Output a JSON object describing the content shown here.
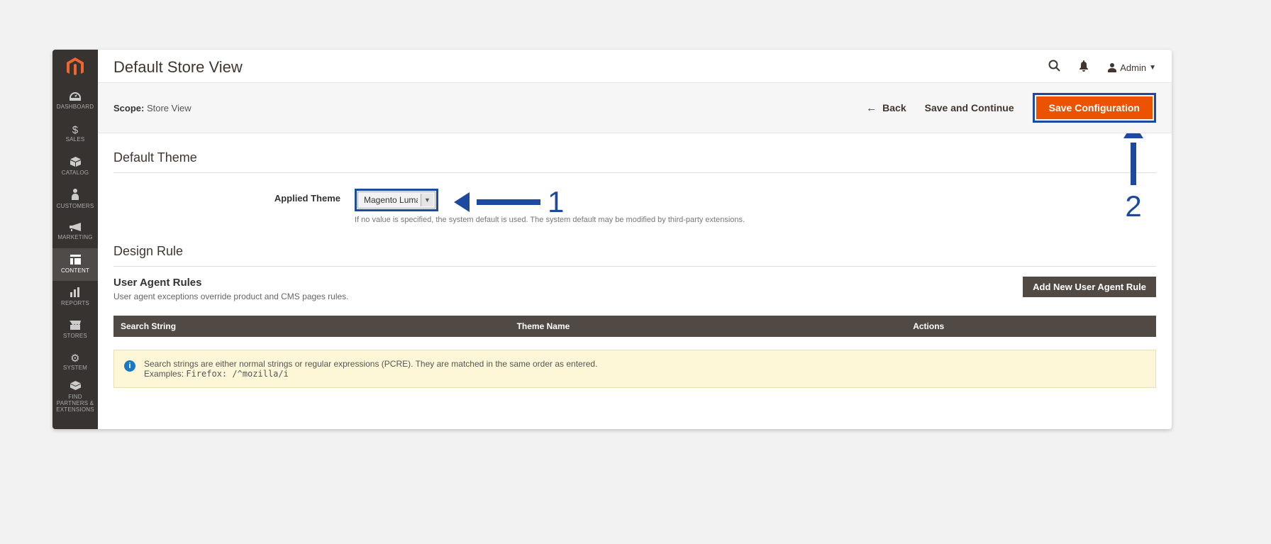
{
  "sidebar": {
    "items": [
      {
        "label": "DASHBOARD"
      },
      {
        "label": "SALES"
      },
      {
        "label": "CATALOG"
      },
      {
        "label": "CUSTOMERS"
      },
      {
        "label": "MARKETING"
      },
      {
        "label": "CONTENT"
      },
      {
        "label": "REPORTS"
      },
      {
        "label": "STORES"
      },
      {
        "label": "SYSTEM"
      },
      {
        "label": "FIND PARTNERS & EXTENSIONS"
      }
    ]
  },
  "header": {
    "title": "Default Store View",
    "user": "Admin"
  },
  "scope": {
    "label": "Scope:",
    "value": "Store View",
    "back": "Back",
    "save_continue": "Save and Continue",
    "save_config": "Save Configuration"
  },
  "default_theme": {
    "heading": "Default Theme",
    "field_label": "Applied Theme",
    "selected": "Magento Luma",
    "help": "If no value is specified, the system default is used. The system default may be modified by third-party extensions."
  },
  "design_rule": {
    "heading": "Design Rule",
    "sub_heading": "User Agent Rules",
    "sub_desc": "User agent exceptions override product and CMS pages rules.",
    "add_button": "Add New User Agent Rule",
    "cols": {
      "search": "Search String",
      "theme": "Theme Name",
      "actions": "Actions"
    },
    "info_line1": "Search strings are either normal strings or regular expressions (PCRE). They are matched in the same order as entered.",
    "info_line2a": "Examples: ",
    "info_line2b": "Firefox: /^mozilla/i"
  },
  "annotations": {
    "one": "1",
    "two": "2"
  }
}
